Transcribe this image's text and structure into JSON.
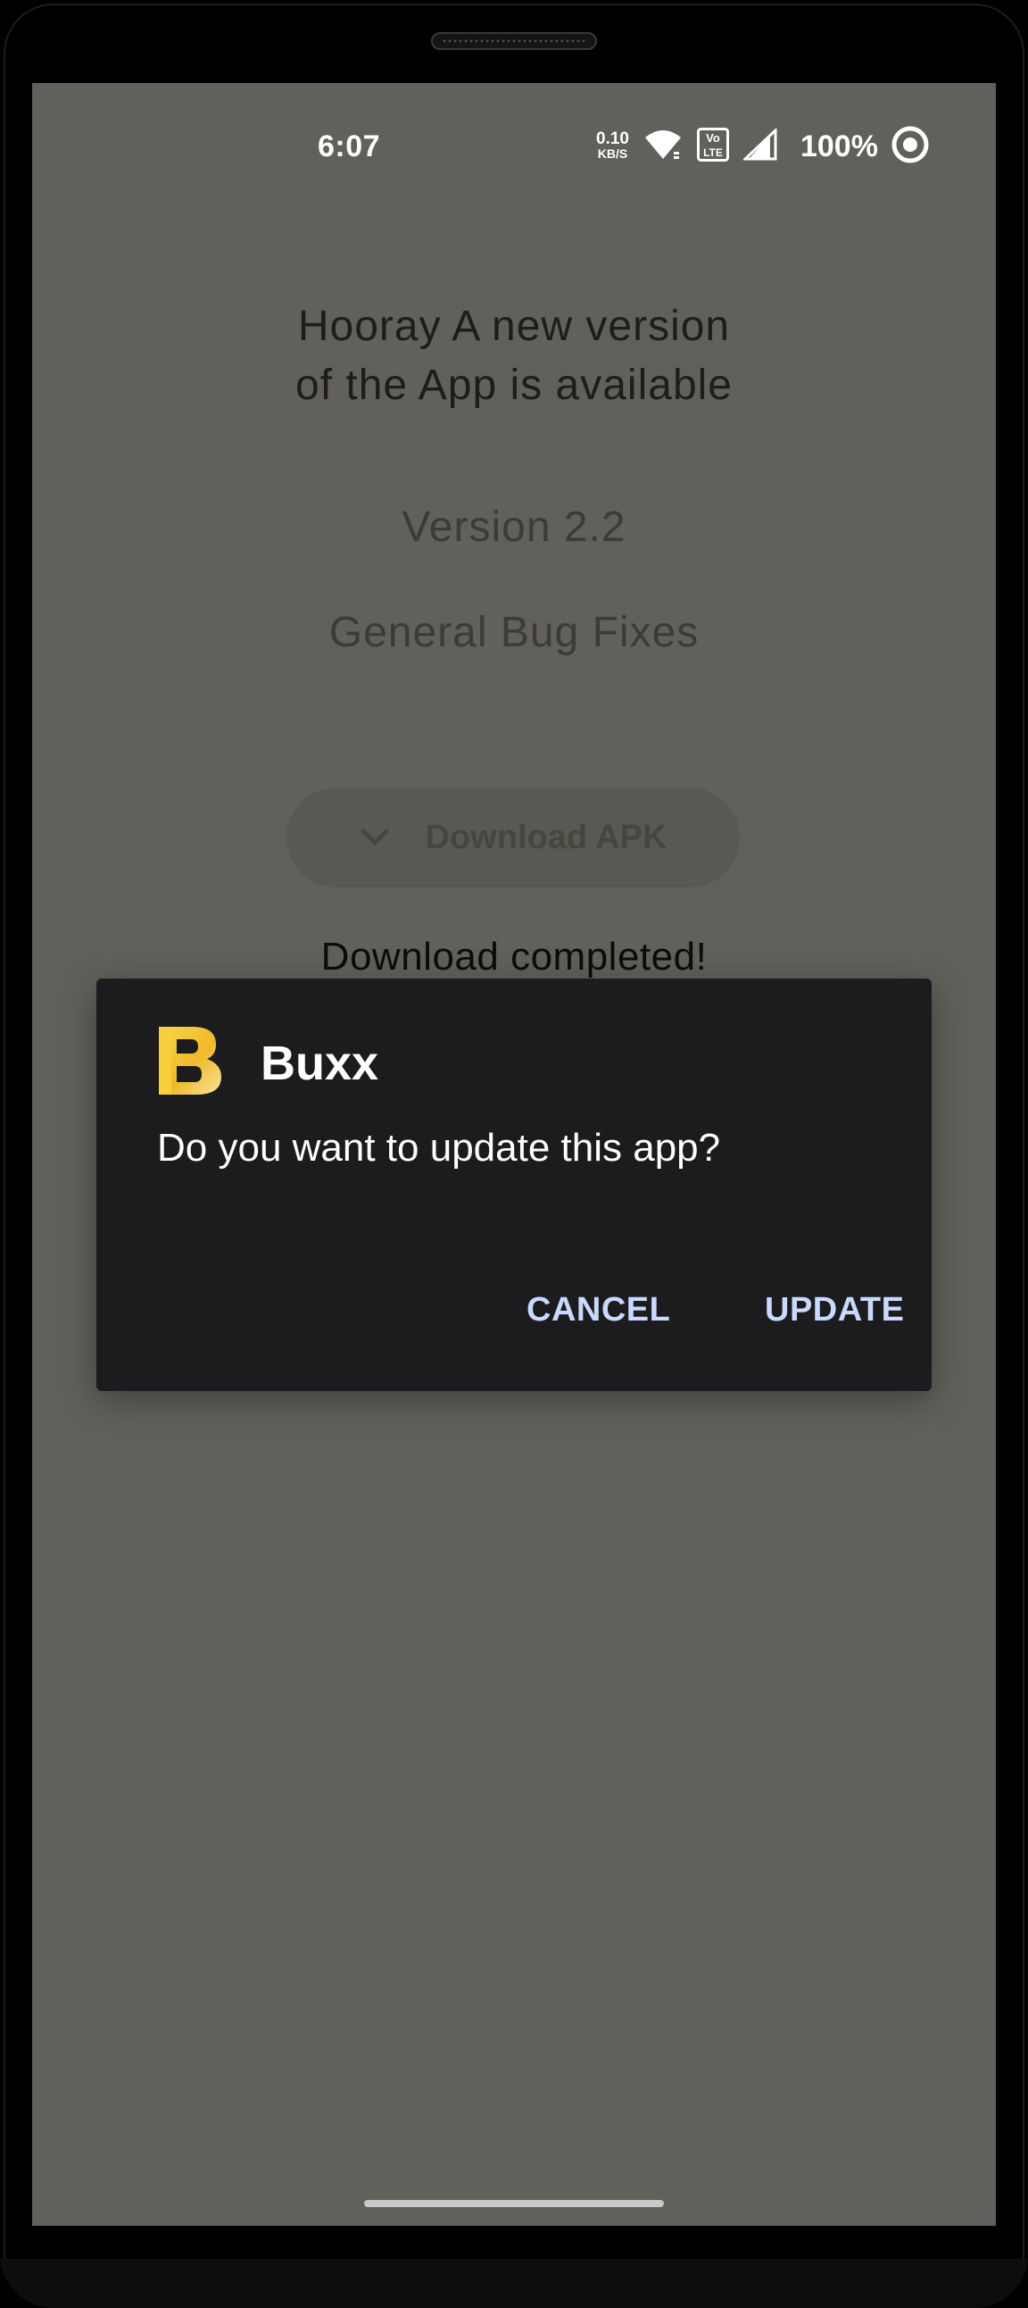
{
  "status_bar": {
    "time": "6:07",
    "net_speed_value": "0.10",
    "net_speed_unit": "KB/S",
    "volte_label_top": "Vo",
    "volte_label_bottom": "LTE",
    "battery": "100%"
  },
  "page": {
    "headline_line1": "Hooray A new version",
    "headline_line2": "of the App is available",
    "version": "Version 2.2",
    "notes": "General Bug Fixes",
    "download_button_label": "Download APK",
    "download_status": "Download completed!"
  },
  "dialog": {
    "title": "Buxx",
    "message": "Do you want to update this app?",
    "cancel_label": "CANCEL",
    "update_label": "UPDATE"
  },
  "colors": {
    "screen_background": "#61605b",
    "dialog_background": "#1c1c1e",
    "dialog_button_text": "#c9d9ff",
    "logo_gold": "#f5c531"
  },
  "icons": {
    "wifi": "wifi-icon",
    "volte": "volte-icon",
    "signal": "cell-signal-icon",
    "ring": "ring-icon",
    "chevron": "chevron-down-icon",
    "logo": "buxx-logo"
  }
}
